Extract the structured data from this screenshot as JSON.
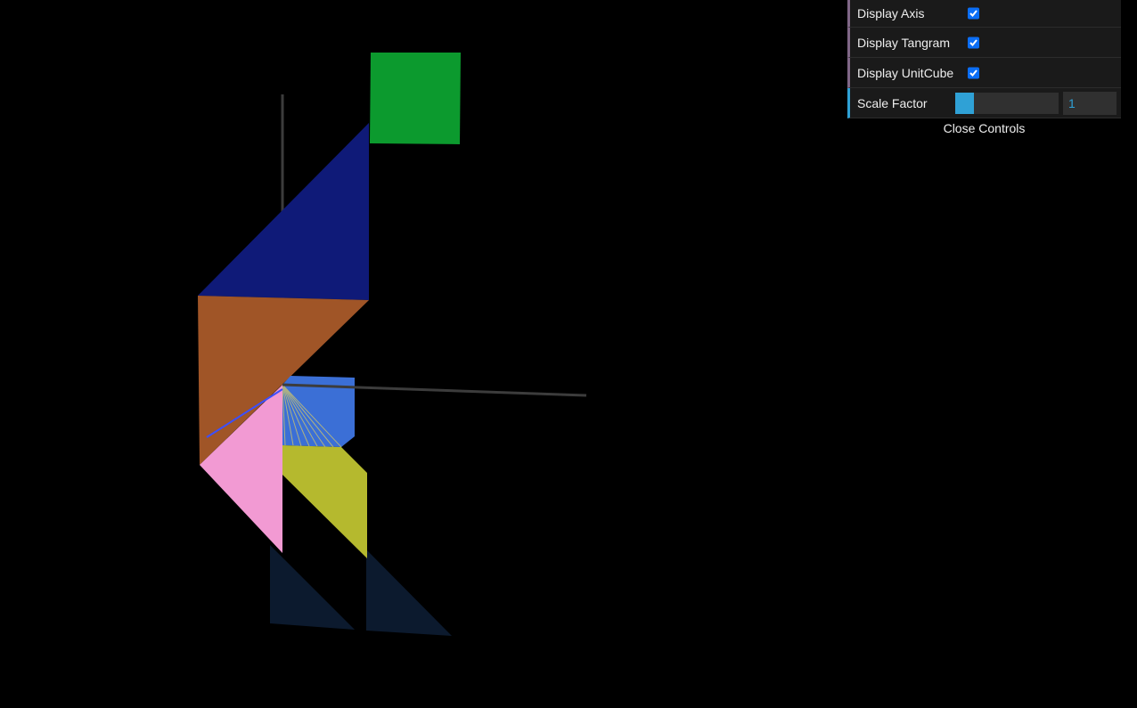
{
  "controls": {
    "display_axis": {
      "label": "Display Axis",
      "checked": true
    },
    "display_tangram": {
      "label": "Display Tangram",
      "checked": true
    },
    "display_unitcube": {
      "label": "Display UnitCube",
      "checked": true
    },
    "scale_factor": {
      "label": "Scale Factor",
      "value": "1",
      "slider_fraction": 0.18
    },
    "close_label": "Close Controls"
  },
  "scene": {
    "background": "#000000",
    "colors": {
      "axis": "#3c3c3c",
      "square": "#0c9a2e",
      "parallelogram": "#0f1a78",
      "large_triangle": "#a05527",
      "pink_triangle": "#f29ad3",
      "blue_cube_face": "#3b6fd6",
      "yellow_parallelogram": "#b5b92e",
      "shadow_triangle": "#0c1a2e",
      "yellow_wire": "#c9c270",
      "blue_diagonal": "#3b4fff"
    }
  }
}
